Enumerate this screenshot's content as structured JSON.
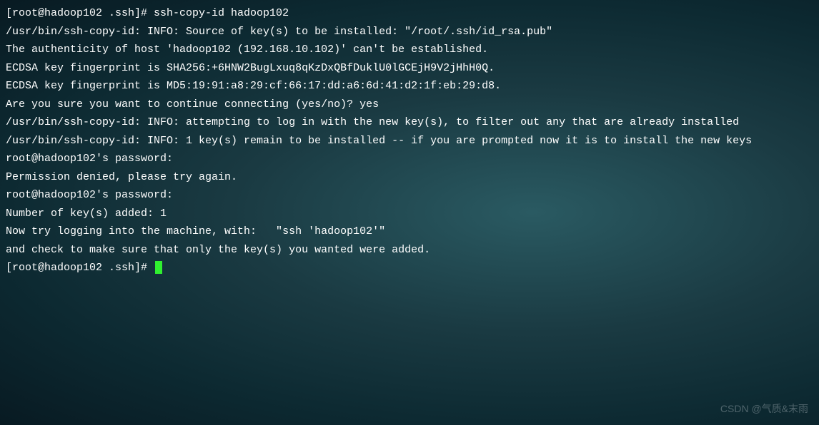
{
  "terminal": {
    "lines": [
      "[root@hadoop102 .ssh]# ssh-copy-id hadoop102",
      "/usr/bin/ssh-copy-id: INFO: Source of key(s) to be installed: \"/root/.ssh/id_rsa.pub\"",
      "The authenticity of host 'hadoop102 (192.168.10.102)' can't be established.",
      "ECDSA key fingerprint is SHA256:+6HNW2BugLxuq8qKzDxQBfDuklU0lGCEjH9V2jHhH0Q.",
      "ECDSA key fingerprint is MD5:19:91:a8:29:cf:66:17:dd:a6:6d:41:d2:1f:eb:29:d8.",
      "Are you sure you want to continue connecting (yes/no)? yes",
      "/usr/bin/ssh-copy-id: INFO: attempting to log in with the new key(s), to filter out any that are already installed",
      "/usr/bin/ssh-copy-id: INFO: 1 key(s) remain to be installed -- if you are prompted now it is to install the new keys",
      "root@hadoop102's password: ",
      "Permission denied, please try again.",
      "root@hadoop102's password: ",
      "",
      "Number of key(s) added: 1",
      "",
      "Now try logging into the machine, with:   \"ssh 'hadoop102'\"",
      "and check to make sure that only the key(s) you wanted were added.",
      "",
      "[root@hadoop102 .ssh]# "
    ]
  },
  "watermark": {
    "text": "CSDN @气质&末雨"
  }
}
